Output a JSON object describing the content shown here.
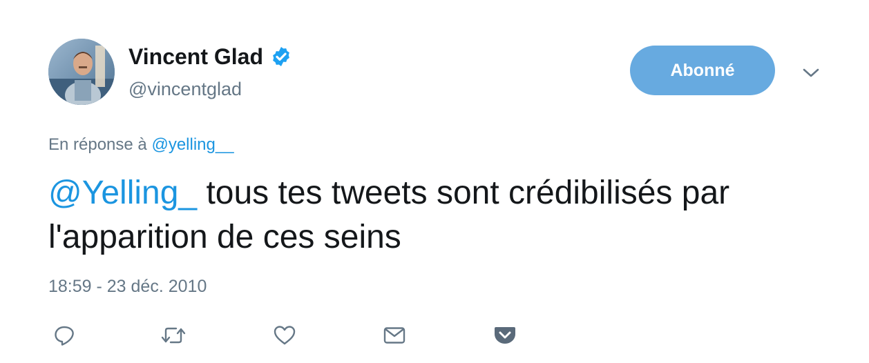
{
  "author": {
    "display_name": "Vincent Glad",
    "handle": "@vincentglad",
    "verified": true
  },
  "follow_button": {
    "label": "Abonné",
    "color": "#67aae0"
  },
  "reply_context": {
    "prefix": "En réponse à",
    "mention": "@yelling__"
  },
  "tweet": {
    "mention": "@Yelling_",
    "text": " tous tes tweets sont crédibilisés par l'apparition de ces seins",
    "timestamp": "18:59 - 23 déc. 2010"
  },
  "actions": [
    {
      "name": "reply",
      "icon": "reply-icon"
    },
    {
      "name": "retweet",
      "icon": "retweet-icon"
    },
    {
      "name": "like",
      "icon": "heart-icon"
    },
    {
      "name": "direct-message",
      "icon": "envelope-icon"
    },
    {
      "name": "pocket",
      "icon": "pocket-icon"
    }
  ],
  "colors": {
    "link": "#1b95e0",
    "secondary_text": "#657786",
    "primary_text": "#14171a",
    "verified": "#1da1f2",
    "action_icon": "#657786",
    "pocket_icon": "#5a6a7a"
  }
}
